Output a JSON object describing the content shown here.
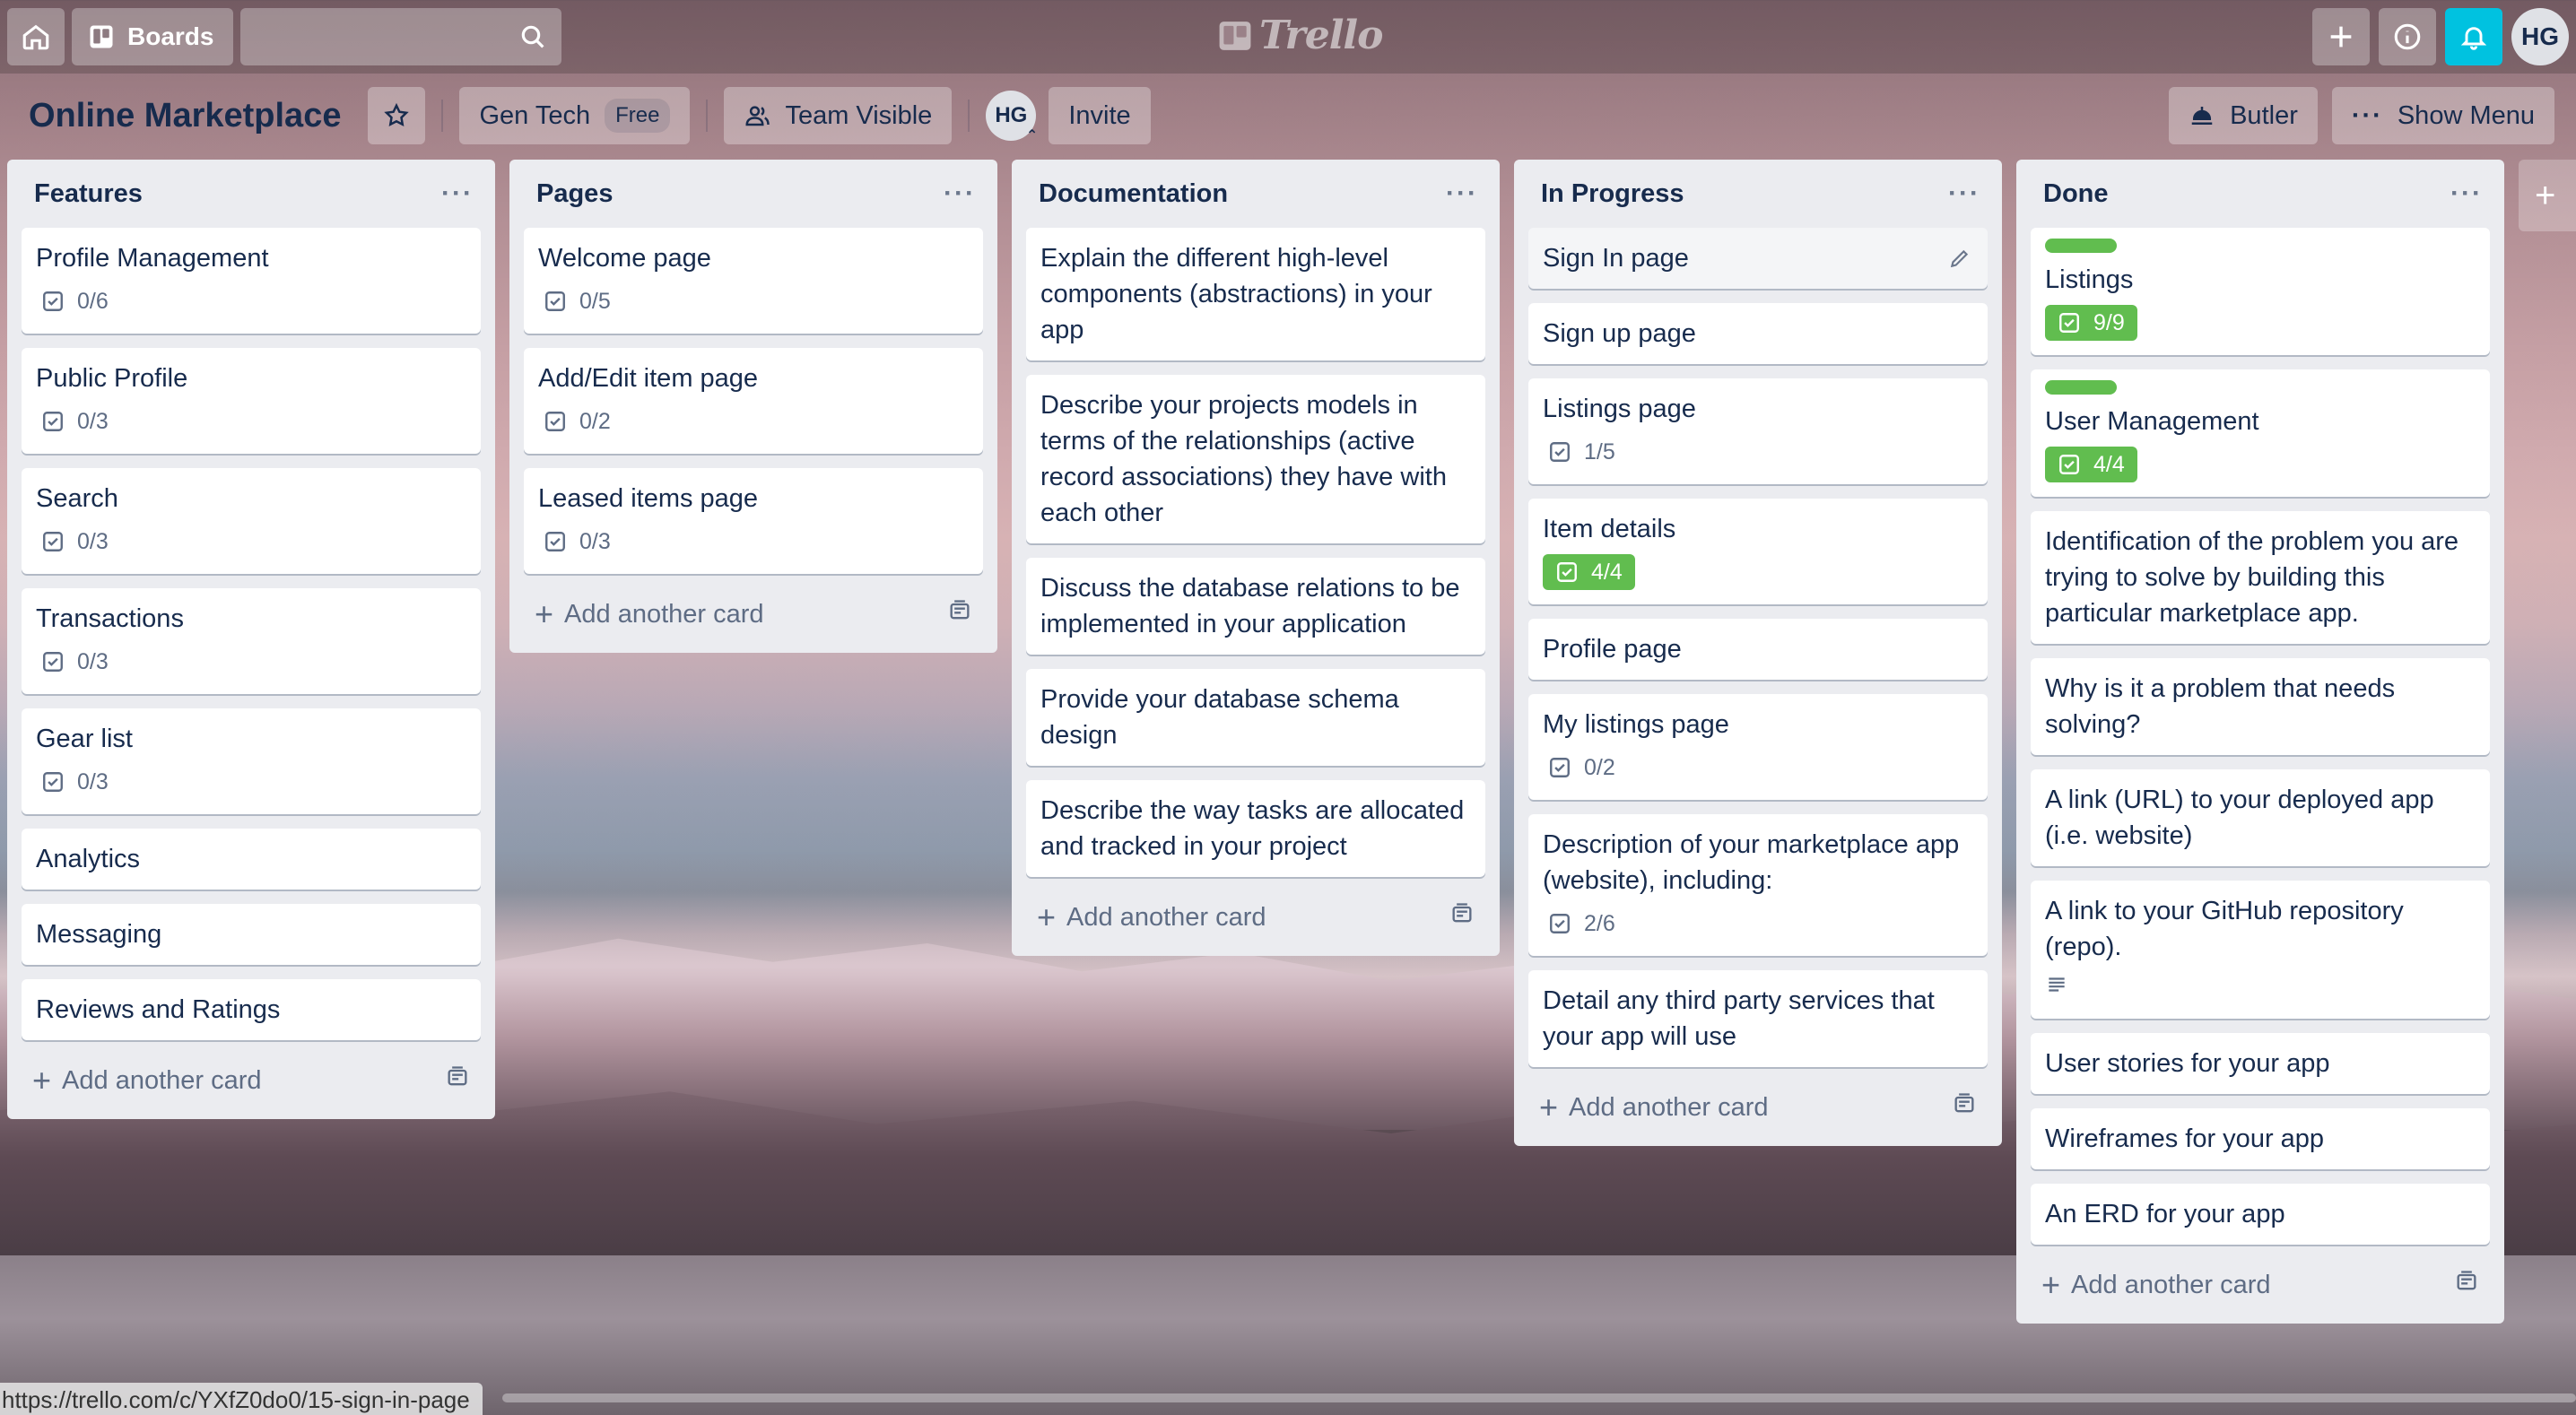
{
  "header": {
    "boards_label": "Boards",
    "search_placeholder": "",
    "logo_text": "Trello",
    "user_initials": "HG"
  },
  "board": {
    "title": "Online Marketplace",
    "team_name": "Gen Tech",
    "team_plan": "Free",
    "visibility": "Team Visible",
    "member_initials": "HG",
    "invite_label": "Invite",
    "butler_label": "Butler",
    "show_menu_label": "Show Menu"
  },
  "add_card_label": "Add another card",
  "lists": [
    {
      "title": "Features",
      "cards": [
        {
          "title": "Profile Management",
          "checklist": "0/6"
        },
        {
          "title": "Public Profile",
          "checklist": "0/3"
        },
        {
          "title": "Search",
          "checklist": "0/3"
        },
        {
          "title": "Transactions",
          "checklist": "0/3"
        },
        {
          "title": "Gear list",
          "checklist": "0/3"
        },
        {
          "title": "Analytics"
        },
        {
          "title": "Messaging"
        },
        {
          "title": "Reviews and Ratings"
        }
      ]
    },
    {
      "title": "Pages",
      "cards": [
        {
          "title": "Welcome page",
          "checklist": "0/5"
        },
        {
          "title": "Add/Edit item page",
          "checklist": "0/2"
        },
        {
          "title": "Leased items page",
          "checklist": "0/3"
        }
      ]
    },
    {
      "title": "Documentation",
      "cards": [
        {
          "title": "Explain the different high-level components (abstractions) in your app"
        },
        {
          "title": "Describe your projects models in terms of the relationships (active record associations) they have with each other"
        },
        {
          "title": "Discuss the database relations to be implemented in your application"
        },
        {
          "title": "Provide your database schema design"
        },
        {
          "title": "Describe the way tasks are allocated and tracked in your project"
        }
      ]
    },
    {
      "title": "In Progress",
      "cards": [
        {
          "title": "Sign In page",
          "hover": true
        },
        {
          "title": "Sign up page"
        },
        {
          "title": "Listings page",
          "checklist": "1/5"
        },
        {
          "title": "Item details",
          "checklist": "4/4",
          "complete": true
        },
        {
          "title": "Profile page"
        },
        {
          "title": "My listings page",
          "checklist": "0/2"
        },
        {
          "title": "Description of your marketplace app (website), including:",
          "checklist": "2/6"
        },
        {
          "title": "Detail any third party services that your app will use"
        }
      ]
    },
    {
      "title": "Done",
      "cards": [
        {
          "title": "Listings",
          "checklist": "9/9",
          "complete": true,
          "label": "green"
        },
        {
          "title": "User Management",
          "checklist": "4/4",
          "complete": true,
          "label": "green"
        },
        {
          "title": "Identification of the problem you are trying to solve by building this particular marketplace app."
        },
        {
          "title": "Why is it a problem that needs solving?"
        },
        {
          "title": "A link (URL) to your deployed app (i.e. website)"
        },
        {
          "title": "A link to your GitHub repository (repo).",
          "description": true
        },
        {
          "title": "User stories for your app"
        },
        {
          "title": "Wireframes for your app"
        },
        {
          "title": "An ERD for your app"
        }
      ]
    }
  ],
  "status_url": "https://trello.com/c/YXfZ0do0/15-sign-in-page",
  "colors": {
    "label_green": "#61bd4f",
    "notification_accent": "#00c2e0",
    "list_bg": "#ebecf0"
  }
}
